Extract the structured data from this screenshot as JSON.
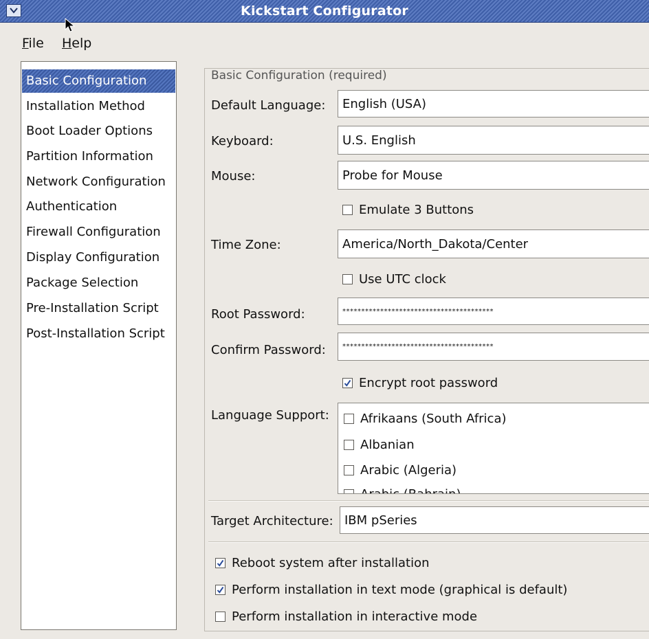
{
  "window": {
    "title": "Kickstart Configurator"
  },
  "menubar": {
    "file": {
      "acc": "F",
      "rest": "ile"
    },
    "help": {
      "acc": "H",
      "rest": "elp"
    }
  },
  "sidebar": {
    "items": [
      {
        "label": "Basic Configuration",
        "selected": true
      },
      {
        "label": "Installation Method"
      },
      {
        "label": "Boot Loader Options"
      },
      {
        "label": "Partition Information"
      },
      {
        "label": "Network Configuration"
      },
      {
        "label": "Authentication"
      },
      {
        "label": "Firewall Configuration"
      },
      {
        "label": "Display Configuration"
      },
      {
        "label": "Package Selection"
      },
      {
        "label": "Pre-Installation Script"
      },
      {
        "label": "Post-Installation Script"
      }
    ]
  },
  "basic": {
    "section_title": "Basic Configuration (required)",
    "default_language": {
      "label": "Default Language:",
      "value": "English (USA)"
    },
    "keyboard": {
      "label": "Keyboard:",
      "value": "U.S. English"
    },
    "mouse": {
      "label": "Mouse:",
      "value": "Probe for Mouse"
    },
    "emulate_3_buttons": {
      "label": "Emulate 3 Buttons",
      "checked": false
    },
    "time_zone": {
      "label": "Time Zone:",
      "value": "America/North_Dakota/Center"
    },
    "use_utc": {
      "label": "Use UTC clock",
      "checked": false
    },
    "root_password": {
      "label": "Root Password:",
      "value": "****************************************"
    },
    "confirm_password": {
      "label": "Confirm Password:",
      "value": "****************************************"
    },
    "encrypt_root": {
      "label": "Encrypt root password",
      "checked": true
    },
    "language_support": {
      "label": "Language Support:",
      "items": [
        {
          "label": "Afrikaans (South Africa)",
          "checked": false
        },
        {
          "label": "Albanian",
          "checked": false
        },
        {
          "label": "Arabic (Algeria)",
          "checked": false
        },
        {
          "label": "Arabic (Bahrain)",
          "checked": false
        }
      ]
    },
    "target_architecture": {
      "label": "Target Architecture:",
      "value": "IBM pSeries"
    },
    "reboot": {
      "label": "Reboot system after installation",
      "checked": true
    },
    "text_mode": {
      "label": "Perform installation in text mode (graphical is default)",
      "checked": true
    },
    "interactive_mode": {
      "label": "Perform installation in interactive mode",
      "checked": false
    }
  },
  "colors": {
    "titlebar": "#3f5fa8",
    "selection": "#3b5aa1",
    "window_bg": "#ece9e4",
    "check_mark": "#2a4c9a"
  },
  "icons": {
    "window_menu": "chevron-down-icon",
    "cursor": "mouse-pointer-icon",
    "check": "checkmark-icon"
  }
}
